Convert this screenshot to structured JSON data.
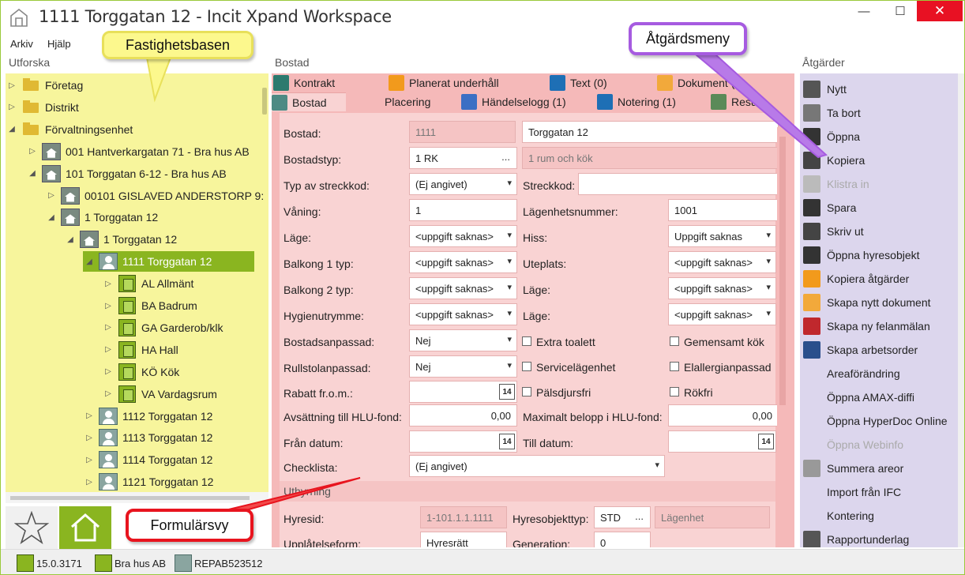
{
  "window": {
    "title": "1111 Torggatan 12 - Incit Xpand Workspace",
    "minimize": "—",
    "maximize": "☐",
    "close": "✕"
  },
  "menu": {
    "arkiv": "Arkiv",
    "hjalp": "Hjälp"
  },
  "panels": {
    "left": "Utforska",
    "center": "Bostad",
    "right": "Åtgärder"
  },
  "tree": {
    "items": [
      {
        "label": "Företag",
        "icon": "folder-icon",
        "level": 0,
        "arrow": "▷"
      },
      {
        "label": "Distrikt",
        "icon": "folder-icon",
        "level": 0,
        "arrow": "▷"
      },
      {
        "label": "Förvaltningsenhet",
        "icon": "folder-icon",
        "level": 0,
        "arrow": "◢"
      },
      {
        "label": "001 Hantverkargatan 71 - Bra hus AB",
        "icon": "property-icon",
        "level": 1,
        "arrow": "▷"
      },
      {
        "label": "101 Torggatan 6-12 - Bra hus AB",
        "icon": "property-icon",
        "level": 1,
        "arrow": "◢"
      },
      {
        "label": "00101 GISLAVED ANDERSTORP 9:",
        "icon": "land-icon",
        "level": 2,
        "arrow": "▷"
      },
      {
        "label": "1 Torggatan 12",
        "icon": "building-icon",
        "level": 2,
        "arrow": "◢"
      },
      {
        "label": "1 Torggatan 12",
        "icon": "entrance-icon",
        "level": 3,
        "arrow": "◢"
      },
      {
        "label": "1111 Torggatan 12",
        "icon": "apartment-icon",
        "level": 4,
        "arrow": "◢",
        "selected": true
      },
      {
        "label": "AL Allmänt",
        "icon": "room-icon",
        "level": 5,
        "arrow": "▷"
      },
      {
        "label": "BA Badrum",
        "icon": "room-icon",
        "level": 5,
        "arrow": "▷"
      },
      {
        "label": "GA Garderob/klk",
        "icon": "room-icon",
        "level": 5,
        "arrow": "▷"
      },
      {
        "label": "HA Hall",
        "icon": "room-icon",
        "level": 5,
        "arrow": "▷"
      },
      {
        "label": "KÖ Kök",
        "icon": "room-icon",
        "level": 5,
        "arrow": "▷"
      },
      {
        "label": "VA Vardagsrum",
        "icon": "room-icon",
        "level": 5,
        "arrow": "▷"
      },
      {
        "label": "1112 Torggatan 12",
        "icon": "apartment-icon",
        "level": 4,
        "arrow": "▷"
      },
      {
        "label": "1113 Torggatan 12",
        "icon": "apartment-icon",
        "level": 4,
        "arrow": "▷"
      },
      {
        "label": "1114 Torggatan 12",
        "icon": "apartment-icon",
        "level": 4,
        "arrow": "▷"
      },
      {
        "label": "1121 Torggatan 12",
        "icon": "apartment-icon",
        "level": 4,
        "arrow": "▷"
      }
    ]
  },
  "tabs_row1": [
    {
      "label": "Kontrakt",
      "icon": "contract-icon",
      "color": "#2d7a6e"
    },
    {
      "label": "Planerat underhåll",
      "icon": "maintenance-icon",
      "color": "#f29a1c"
    },
    {
      "label": "Text (0)",
      "icon": "text-icon",
      "color": "#1e6fb5"
    },
    {
      "label": "Dokument (",
      "icon": "document-icon",
      "color": "#f2a93b"
    }
  ],
  "tabs_row2": [
    {
      "label": "Bostad",
      "icon": "apartment-icon",
      "color": "#4d8a84",
      "active": true
    },
    {
      "label": "Placering",
      "icon": "",
      "color": ""
    },
    {
      "label": "Händelselogg (1)",
      "icon": "event-log-icon",
      "color": "#3b6fc4"
    },
    {
      "label": "Notering (1)",
      "icon": "note-icon",
      "color": "#1e6fb5"
    },
    {
      "label": "Resu",
      "icon": "resource-icon",
      "color": "#5a8a58"
    }
  ],
  "form": {
    "bostad_label": "Bostad:",
    "bostad_id": "1111",
    "bostad_name": "Torggatan 12",
    "bostadstyp_label": "Bostadstyp:",
    "bostadstyp": "1 RK",
    "bostadstyp_desc": "1 rum och kök",
    "streckkod_typ_label": "Typ av streckkod:",
    "streckkod_typ": "(Ej angivet)",
    "streckkod_label": "Streckkod:",
    "streckkod": "",
    "vaning_label": "Våning:",
    "vaning": "1",
    "lghnr_label": "Lägenhetsnummer:",
    "lghnr": "1001",
    "lage_label": "Läge:",
    "lage": "<uppgift saknas>",
    "hiss_label": "Hiss:",
    "hiss": "Uppgift saknas",
    "balkong1_label": "Balkong 1 typ:",
    "balkong1": "<uppgift saknas>",
    "uteplats_label": "Uteplats:",
    "uteplats": "<uppgift saknas>",
    "balkong2_label": "Balkong 2 typ:",
    "balkong2": "<uppgift saknas>",
    "lage2_label": "Läge:",
    "lage2": "<uppgift saknas>",
    "hygien_label": "Hygienutrymme:",
    "hygien": "<uppgift saknas>",
    "lage3_label": "Läge:",
    "lage3": "<uppgift saknas>",
    "anpassad_label": "Bostadsanpassad:",
    "anpassad": "Nej",
    "extra_toalett": "Extra toalett",
    "gemensamt_kok": "Gemensamt kök",
    "rullstol_label": "Rullstolanpassad:",
    "rullstol": "Nej",
    "servicelgh": "Servicelägenhet",
    "elallergi": "Elallergianpassad",
    "rabatt_label": "Rabatt fr.o.m.:",
    "rabatt": "",
    "palsdjur": "Pälsdjursfri",
    "rokfri": "Rökfri",
    "hlu_label": "Avsättning till HLU-fond:",
    "hlu": "0,00",
    "maxbelopp_label": "Maximalt belopp i HLU-fond:",
    "maxbelopp": "0,00",
    "fran_label": "Från datum:",
    "fran": "",
    "till_label": "Till datum:",
    "till": "",
    "checklista_label": "Checklista:",
    "checklista": "(Ej angivet)",
    "cal_text": "14"
  },
  "uthyrning": {
    "section_title": "Uthyrning",
    "hyresid_label": "Hyresid:",
    "hyresid": "1-101.1.1.1111",
    "hyresobjekttyp_label": "Hyresobjekttyp:",
    "hyresobjekttyp": "STD",
    "hyresobjekttyp_desc": "Lägenhet",
    "upplatelseform_label": "Upplåtelseform:",
    "upplatelseform": "Hyresrätt",
    "generation_label": "Generation:",
    "generation": "0"
  },
  "actions": [
    {
      "label": "Nytt",
      "icon": "new-icon",
      "enabled": true
    },
    {
      "label": "Ta bort",
      "icon": "trash-icon",
      "enabled": true
    },
    {
      "label": "Öppna",
      "icon": "open-folder-icon",
      "enabled": true
    },
    {
      "label": "Kopiera",
      "icon": "copy-icon",
      "enabled": true
    },
    {
      "label": "Klistra in",
      "icon": "paste-icon",
      "enabled": false
    },
    {
      "label": "Spara",
      "icon": "save-icon",
      "enabled": true
    },
    {
      "label": "Skriv ut",
      "icon": "print-icon",
      "enabled": true
    },
    {
      "label": "Öppna hyresobjekt",
      "icon": "open-folder-icon",
      "enabled": true
    },
    {
      "label": "Kopiera åtgärder",
      "icon": "maintenance-icon",
      "enabled": true
    },
    {
      "label": "Skapa nytt dokument",
      "icon": "document-icon",
      "enabled": true
    },
    {
      "label": "Skapa ny felanmälan",
      "icon": "fault-report-icon",
      "enabled": true
    },
    {
      "label": "Skapa arbetsorder",
      "icon": "work-order-icon",
      "enabled": true
    },
    {
      "label": "Areaförändring",
      "icon": "",
      "enabled": true
    },
    {
      "label": "Öppna AMAX-diffi",
      "icon": "",
      "enabled": true
    },
    {
      "label": "Öppna HyperDoc Online",
      "icon": "",
      "enabled": true
    },
    {
      "label": "Öppna Webinfo",
      "icon": "",
      "enabled": false
    },
    {
      "label": "Summera areor",
      "icon": "sum-icon",
      "enabled": true
    },
    {
      "label": "Import från IFC",
      "icon": "",
      "enabled": true
    },
    {
      "label": "Kontering",
      "icon": "",
      "enabled": true
    },
    {
      "label": "Rapportunderlag",
      "icon": "report-icon",
      "enabled": true
    }
  ],
  "status": {
    "version": "15.0.3171",
    "company": "Bra hus AB",
    "user": "REPAB523512"
  },
  "callouts": {
    "fastighetsbasen": "Fastighetsbasen",
    "atgardsmeny": "Åtgärdsmeny",
    "formularsvy": "Formulärsvy"
  },
  "colors": {
    "accent_green": "#8ab520",
    "tree_bg": "#f7f59c",
    "form_bg": "#f9d3d3",
    "actions_bg": "#dcd6ed",
    "close_red": "#e81123"
  }
}
